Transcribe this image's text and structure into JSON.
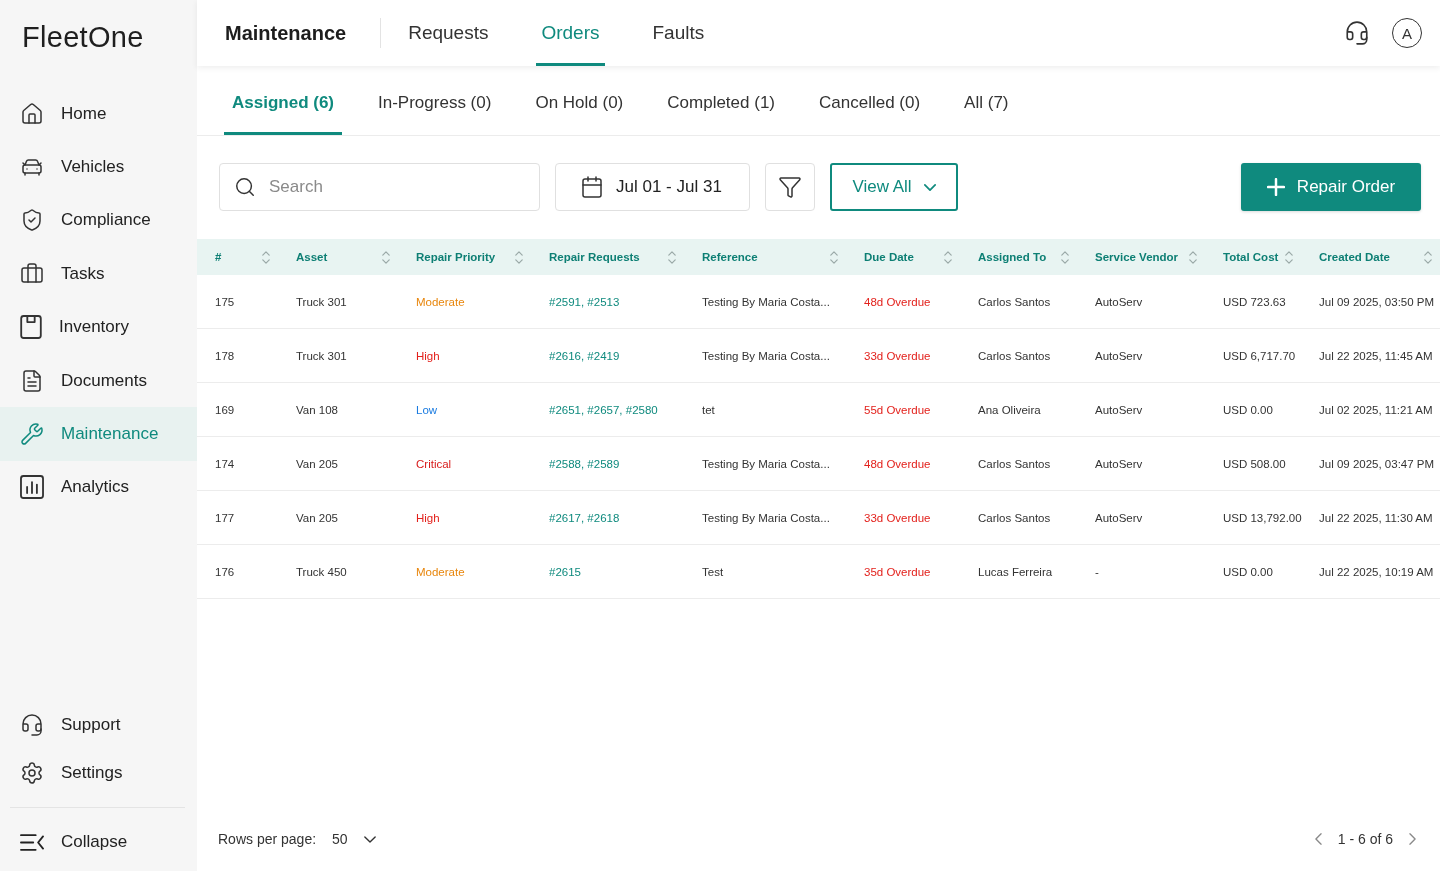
{
  "sidebar": {
    "logo": "FleetOne",
    "items": [
      {
        "label": "Home",
        "selected": false
      },
      {
        "label": "Vehicles",
        "selected": false
      },
      {
        "label": "Compliance",
        "selected": false
      },
      {
        "label": "Tasks",
        "selected": false
      },
      {
        "label": "Inventory",
        "selected": false
      },
      {
        "label": "Documents",
        "selected": false
      },
      {
        "label": "Maintenance",
        "selected": true
      },
      {
        "label": "Analytics",
        "selected": false
      }
    ],
    "footer_items": [
      {
        "label": "Support",
        "selected": false
      },
      {
        "label": "Settings",
        "selected": false
      }
    ],
    "collapse": "Collapse"
  },
  "header": {
    "title": "Maintenance",
    "tabs": [
      {
        "label": "Requests",
        "selected": false
      },
      {
        "label": "Orders",
        "selected": true
      },
      {
        "label": "Faults",
        "selected": false
      }
    ],
    "avatar": "A"
  },
  "subtabs": [
    {
      "label": "Assigned (6)",
      "selected": true
    },
    {
      "label": "In-Progress (0)",
      "selected": false
    },
    {
      "label": "On Hold (0)",
      "selected": false
    },
    {
      "label": "Completed (1)",
      "selected": false
    },
    {
      "label": "Cancelled (0)",
      "selected": false
    },
    {
      "label": "All (7)",
      "selected": false
    }
  ],
  "toolbar": {
    "search": {
      "placeholder": "Search"
    },
    "date_range": "Jul 01 - Jul 31",
    "view": "View All",
    "primary_button": "Repair Order"
  },
  "table": {
    "columns": [
      "#",
      "Asset",
      "Repair Priority",
      "Repair Requests",
      "Reference",
      "Due Date",
      "Assigned To",
      "Service Vendor",
      "Total Cost",
      "Created Date"
    ],
    "rows": [
      {
        "id": "175",
        "asset": "Truck 301",
        "priority": {
          "label": "Moderate",
          "color": "#e8860c"
        },
        "repair_requests": "#2591, #2513",
        "reference": "Testing By Maria Costa...",
        "due_date": "48d Overdue",
        "overdue": true,
        "assigned_to": "Carlos Santos",
        "service_vendor": "AutoServ",
        "total_cost": "USD 723.63",
        "created_date": "Jul 09 2025, 03:50 PM"
      },
      {
        "id": "178",
        "asset": "Truck 301",
        "priority": {
          "label": "High",
          "color": "#e3211c"
        },
        "repair_requests": "#2616, #2419",
        "reference": "Testing By Maria Costa...",
        "due_date": "33d Overdue",
        "overdue": true,
        "assigned_to": "Carlos Santos",
        "service_vendor": "AutoServ",
        "total_cost": "USD 6,717.70",
        "created_date": "Jul 22 2025, 11:45 AM"
      },
      {
        "id": "169",
        "asset": "Van 108",
        "priority": {
          "label": "Low",
          "color": "#1a7be0"
        },
        "repair_requests": "#2651, #2657, #2580",
        "reference": "tet",
        "due_date": "55d Overdue",
        "overdue": true,
        "assigned_to": "Ana Oliveira",
        "service_vendor": "AutoServ",
        "total_cost": "USD 0.00",
        "created_date": "Jul 02 2025, 11:21 AM"
      },
      {
        "id": "174",
        "asset": "Van 205",
        "priority": {
          "label": "Critical",
          "color": "#d81b1b"
        },
        "repair_requests": "#2588, #2589",
        "reference": "Testing By Maria Costa...",
        "due_date": "48d Overdue",
        "overdue": true,
        "assigned_to": "Carlos Santos",
        "service_vendor": "AutoServ",
        "total_cost": "USD 508.00",
        "created_date": "Jul 09 2025, 03:47 PM"
      },
      {
        "id": "177",
        "asset": "Van 205",
        "priority": {
          "label": "High",
          "color": "#e3211c"
        },
        "repair_requests": "#2617, #2618",
        "reference": "Testing By Maria Costa...",
        "due_date": "33d Overdue",
        "overdue": true,
        "assigned_to": "Carlos Santos",
        "service_vendor": "AutoServ",
        "total_cost": "USD 13,792.00",
        "created_date": "Jul 22 2025, 11:30 AM"
      },
      {
        "id": "176",
        "asset": "Truck 450",
        "priority": {
          "label": "Moderate",
          "color": "#e8860c"
        },
        "repair_requests": "#2615",
        "reference": "Test",
        "due_date": "35d Overdue",
        "overdue": true,
        "assigned_to": "Lucas Ferreira",
        "service_vendor": "-",
        "total_cost": "USD 0.00",
        "created_date": "Jul 22 2025, 10:19 AM"
      }
    ]
  },
  "footer": {
    "rows_per_page_label": "Rows per page:",
    "rows_per_page": "50",
    "range": "1 - 6 of 6"
  }
}
